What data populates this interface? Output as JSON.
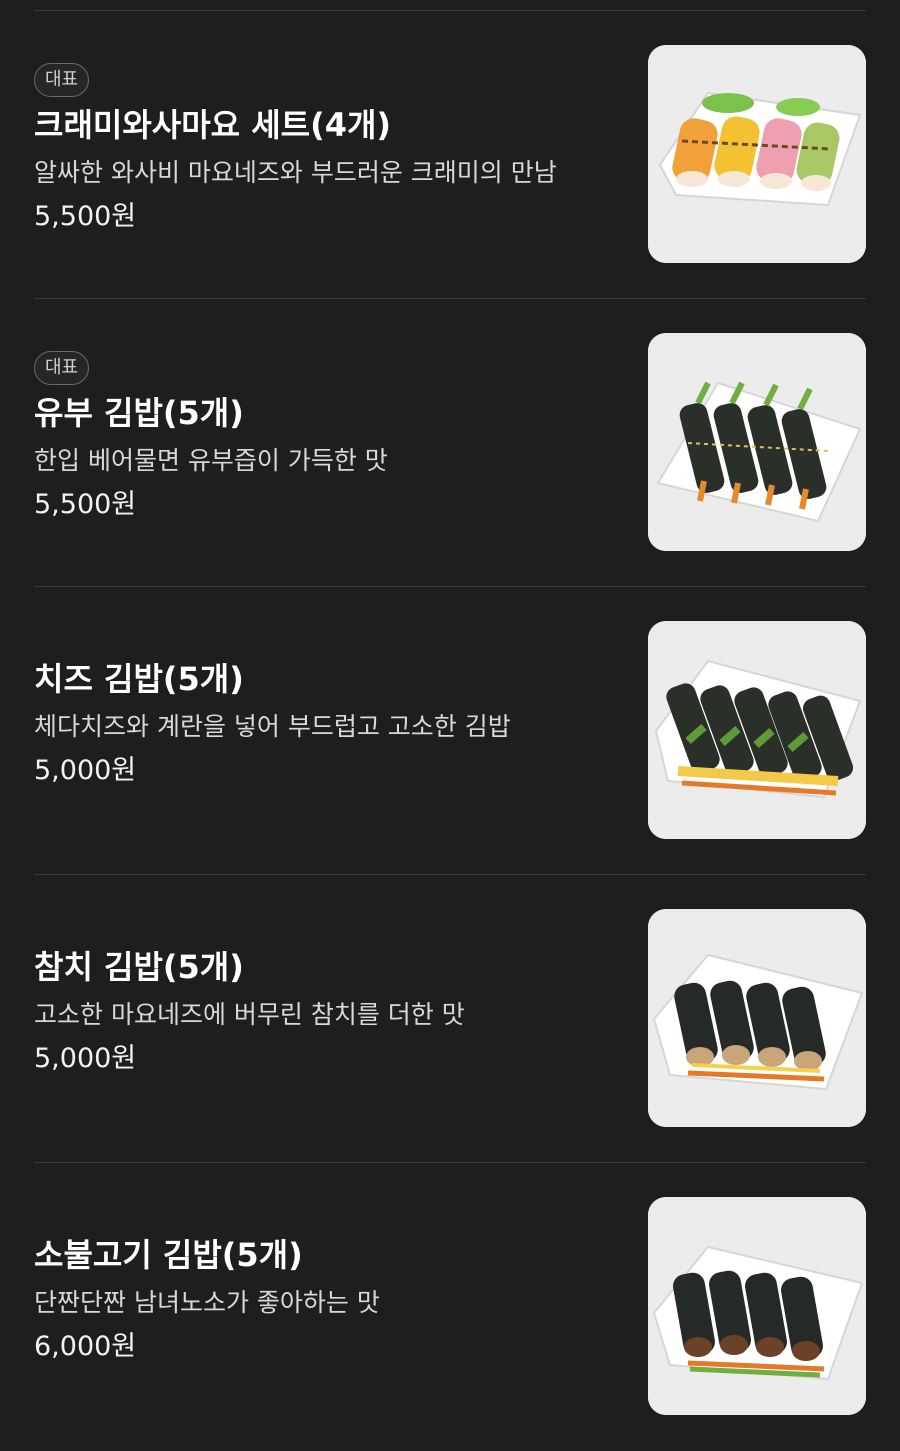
{
  "menu": {
    "items": [
      {
        "badge": "대표",
        "name": "크래미와사마요 세트(4개)",
        "description": "알싸한 와사비 마요네즈와 부드러운 크래미의 만남",
        "price": "5,500원",
        "image_icon": "crab-wasabi-mayo-roll-photo"
      },
      {
        "badge": "대표",
        "name": "유부 김밥(5개)",
        "description": "한입 베어물면 유부즙이 가득한 맛",
        "price": "5,500원",
        "image_icon": "yubu-kimbap-photo"
      },
      {
        "badge": "",
        "name": "치즈 김밥(5개)",
        "description": "체다치즈와 계란을 넣어 부드럽고 고소한 김밥",
        "price": "5,000원",
        "image_icon": "cheese-kimbap-photo"
      },
      {
        "badge": "",
        "name": "참치 김밥(5개)",
        "description": "고소한 마요네즈에 버무린 참치를 더한 맛",
        "price": "5,000원",
        "image_icon": "tuna-kimbap-photo"
      },
      {
        "badge": "",
        "name": "소불고기 김밥(5개)",
        "description": "단짠단짠 남녀노소가 좋아하는 맛",
        "price": "6,000원",
        "image_icon": "bulgogi-kimbap-photo"
      }
    ]
  },
  "colors": {
    "background": "#1e1e1e",
    "divider": "#3a3a3a",
    "badge_border": "#6a6a6a",
    "thumb_bg": "#ececec"
  }
}
